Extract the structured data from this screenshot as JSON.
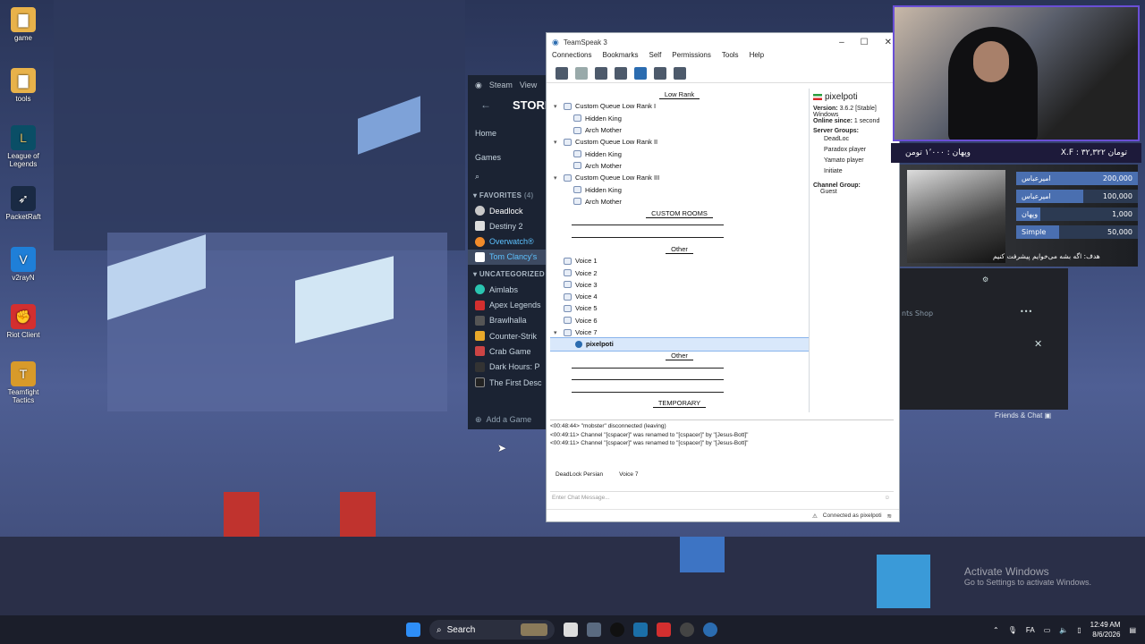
{
  "desktop": {
    "icons": [
      {
        "label": "game",
        "icon": "folder-icon",
        "color": "#e8b24a"
      },
      {
        "label": "tools",
        "icon": "folder-icon",
        "color": "#e8b24a"
      },
      {
        "label": "League of Legends",
        "icon": "league-icon",
        "color": "#0a4e66"
      },
      {
        "label": "PacketRaft",
        "icon": "packetraft-icon",
        "color": "#1a2a44"
      },
      {
        "label": "v2rayN",
        "icon": "v2rayn-icon",
        "color": "#1f7fd8"
      },
      {
        "label": "Riot Client",
        "icon": "riot-icon",
        "color": "#d32f2f"
      },
      {
        "label": "Teamfight Tactics",
        "icon": "tft-icon",
        "color": "#d89a2a"
      }
    ]
  },
  "steam": {
    "menu": [
      "Steam",
      "View"
    ],
    "store_title": "STORE",
    "nav": [
      "Home",
      "Games"
    ],
    "favorites_header": "FAVORITES",
    "favorites_count": "(4)",
    "favorites": [
      "Deadlock",
      "Destiny 2",
      "Overwatch®",
      "Tom Clancy's"
    ],
    "uncategorized_header": "UNCATEGORIZED",
    "uncategorized": [
      "Aimlabs",
      "Apex Legends",
      "Brawlhalla",
      "Counter-Strik",
      "Crab Game",
      "Dark Hours: P",
      "The First Desc"
    ],
    "add_game": "Add a Game"
  },
  "teamspeak": {
    "title": "TeamSpeak 3",
    "menu": [
      "Connections",
      "Bookmarks",
      "Self",
      "Permissions",
      "Tools",
      "Help"
    ],
    "tree": [
      {
        "text": "Low Rank",
        "kind": "spacer"
      },
      {
        "text": "Custom Queue Low Rank I",
        "kind": "channel",
        "expand": true
      },
      {
        "text": "Hidden King",
        "kind": "sub"
      },
      {
        "text": "Arch Mother",
        "kind": "sub"
      },
      {
        "text": "Custom Queue Low Rank II",
        "kind": "channel",
        "expand": true
      },
      {
        "text": "Hidden King",
        "kind": "sub"
      },
      {
        "text": "Arch Mother",
        "kind": "sub"
      },
      {
        "text": "Custom Queue Low Rank III",
        "kind": "channel",
        "expand": true
      },
      {
        "text": "Hidden King",
        "kind": "sub"
      },
      {
        "text": "Arch Mother",
        "kind": "sub"
      },
      {
        "text": "CUSTOM ROOMS",
        "kind": "spacer"
      },
      {
        "text": "",
        "kind": "blank"
      },
      {
        "text": "",
        "kind": "blank"
      },
      {
        "text": "Other",
        "kind": "spacer"
      },
      {
        "text": "Voice 1",
        "kind": "voice"
      },
      {
        "text": "Voice 2",
        "kind": "voice"
      },
      {
        "text": "Voice 3",
        "kind": "voice"
      },
      {
        "text": "Voice 4",
        "kind": "voice"
      },
      {
        "text": "Voice 5",
        "kind": "voice"
      },
      {
        "text": "Voice 6",
        "kind": "voice"
      },
      {
        "text": "Voice 7",
        "kind": "voice",
        "expand": true
      },
      {
        "text": "pixelpoti",
        "kind": "user"
      },
      {
        "text": "Other",
        "kind": "spacer"
      },
      {
        "text": "",
        "kind": "blank"
      },
      {
        "text": "",
        "kind": "blank"
      },
      {
        "text": "",
        "kind": "blank"
      },
      {
        "text": "TEMPORARY",
        "kind": "spacer"
      }
    ],
    "info": {
      "username": "pixelpoti",
      "version_label": "Version:",
      "version_value": "3.6.2 [Stable] Windows",
      "online_label": "Online since:",
      "online_value": "1 second",
      "server_groups_label": "Server Groups:",
      "server_groups": [
        "DeadLoc",
        "Paradox player",
        "Yamato player",
        "Initiate"
      ],
      "channel_group_label": "Channel Group:",
      "channel_group": "Guest"
    },
    "log": [
      "<00:48:44> \"mobster\" disconnected (leaving)",
      "<00:49:11> Channel \"[cspacer]\" was renamed to \"[cspacer]\" by \"[Jesus-Bott]\"",
      "<00:49:11> Channel \"[cspacer]\" was renamed to \"[cspacer]\" by \"[Jesus-Bott]\""
    ],
    "tabs": [
      "DeadLock Persian",
      "Voice 7"
    ],
    "chat_placeholder": "Enter Chat Message...",
    "status": "Connected as pixelpoti"
  },
  "overlay": {
    "dono_bar_left": "وپهان : ۱٬۰۰۰ تومن",
    "dono_bar_right": "X.F : ۳۲,۳۲۲ تومان",
    "donations": [
      {
        "name": "امیرعباس",
        "amount": "200,000",
        "fill": 1.0
      },
      {
        "name": "امیرعباس",
        "amount": "100,000",
        "fill": 0.55
      },
      {
        "name": "وپهان",
        "amount": "1,000",
        "fill": 0.2
      },
      {
        "name": "Simple",
        "amount": "50,000",
        "fill": 0.35
      }
    ],
    "goal_text": "هدف: اگه بشه می‌خوایم پیشرفت کنیم"
  },
  "riot": {
    "shop": "nts Shop",
    "friends": "Friends & Chat"
  },
  "activate": {
    "line1": "Activate Windows",
    "line2": "Go to Settings to activate Windows."
  },
  "taskbar": {
    "search": "Search",
    "time": "12:49 AM",
    "date": "8/6/2026",
    "lang": "FA"
  }
}
